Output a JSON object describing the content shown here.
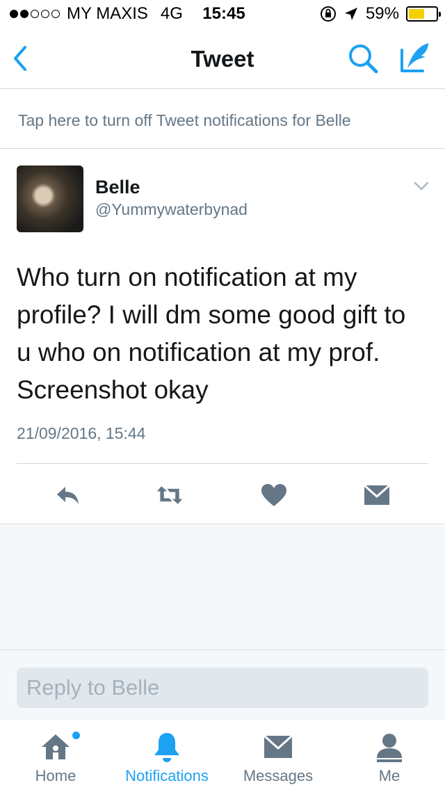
{
  "status_bar": {
    "carrier": "MY MAXIS",
    "network": "4G",
    "time": "15:45",
    "battery": "59%",
    "battery_level": 0.59,
    "signal_bars_filled": 2,
    "signal_bars_total": 5
  },
  "nav": {
    "title": "Tweet",
    "back_icon": "chevron-left-icon",
    "search_icon": "search-icon",
    "compose_icon": "compose-icon",
    "accent_color": "#1da1f2"
  },
  "notification_banner": {
    "text": "Tap here to turn off Tweet notifications for Belle"
  },
  "tweet": {
    "author_name": "Belle",
    "author_handle": "@Yummywaterbynad",
    "text": "Who turn on notification at my profile? I will dm some good gift to u who on notification at my prof. Screenshot okay",
    "timestamp": "21/09/2016, 15:44",
    "actions": [
      "reply-icon",
      "retweet-icon",
      "like-icon",
      "direct-message-icon"
    ]
  },
  "reply": {
    "placeholder": "Reply to Belle"
  },
  "tabbar": {
    "tabs": [
      {
        "label": "Home",
        "icon": "home-icon",
        "active": false,
        "has_badge": true
      },
      {
        "label": "Notifications",
        "icon": "bell-icon",
        "active": true,
        "has_badge": false
      },
      {
        "label": "Messages",
        "icon": "envelope-icon",
        "active": false,
        "has_badge": false
      },
      {
        "label": "Me",
        "icon": "person-icon",
        "active": false,
        "has_badge": false
      }
    ]
  }
}
